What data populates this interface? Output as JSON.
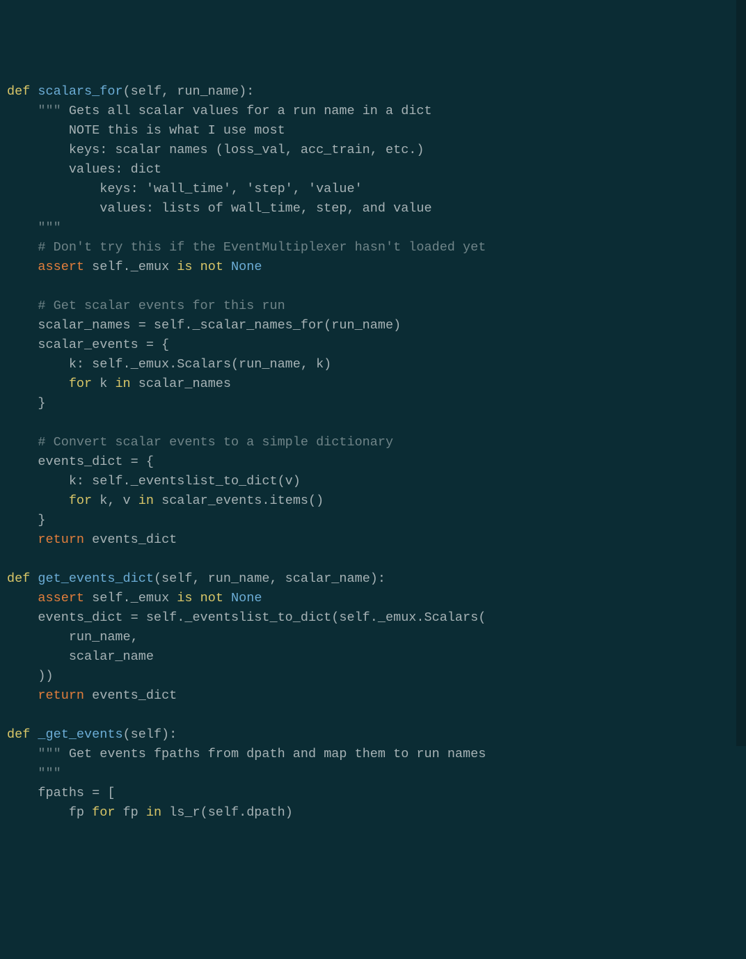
{
  "code": {
    "l1": {
      "def": "def",
      "fn": "scalars_for",
      "rest": "(self, run_name):"
    },
    "l2": {
      "q": "\"\"\"",
      "txt": " Gets all scalar values for a run name in a dict"
    },
    "l3": "        NOTE this is what I use most",
    "l4": "        keys: scalar names (loss_val, acc_train, etc.)",
    "l5": "        values: dict",
    "l6": "            keys: 'wall_time', 'step', 'value'",
    "l7": "            values: lists of wall_time, step, and value",
    "l8": "    \"\"\"",
    "l9": "    # Don't try this if the EventMultiplexer hasn't loaded yet",
    "l10": {
      "assert": "assert",
      "mid": " self._emux ",
      "is": "is",
      "sp1": " ",
      "not": "not",
      "sp2": " ",
      "none": "None"
    },
    "l11": "",
    "l12": "    # Get scalar events for this run",
    "l13": "    scalar_names = self._scalar_names_for(run_name)",
    "l14": "    scalar_events = {",
    "l15": "        k: self._emux.Scalars(run_name, k)",
    "l16": {
      "pre": "        ",
      "for": "for",
      "mid": " k ",
      "in": "in",
      "rest": " scalar_names"
    },
    "l17": "    }",
    "l18": "",
    "l19": "    # Convert scalar events to a simple dictionary",
    "l20": "    events_dict = {",
    "l21": "        k: self._eventslist_to_dict(v)",
    "l22": {
      "pre": "        ",
      "for": "for",
      "mid": " k, v ",
      "in": "in",
      "rest": " scalar_events.items()"
    },
    "l23": "    }",
    "l24": {
      "ret": "return",
      "rest": " events_dict"
    },
    "l25": "",
    "l26": {
      "def": "def",
      "fn": "get_events_dict",
      "rest": "(self, run_name, scalar_name):"
    },
    "l27": {
      "assert": "assert",
      "mid": " self._emux ",
      "is": "is",
      "sp1": " ",
      "not": "not",
      "sp2": " ",
      "none": "None"
    },
    "l28": "    events_dict = self._eventslist_to_dict(self._emux.Scalars(",
    "l29": "        run_name,",
    "l30": "        scalar_name",
    "l31": "    ))",
    "l32": {
      "ret": "return",
      "rest": " events_dict"
    },
    "l33": "",
    "l34": {
      "def": "def",
      "fn": "_get_events",
      "rest": "(self):"
    },
    "l35": {
      "q": "\"\"\"",
      "txt": " Get events fpaths from dpath and map them to run names"
    },
    "l36": "    \"\"\"",
    "l37": "    fpaths = [",
    "l38": {
      "pre": "        fp ",
      "for": "for",
      "mid": " fp ",
      "in": "in",
      "rest": " ls_r(self.dpath)"
    }
  }
}
